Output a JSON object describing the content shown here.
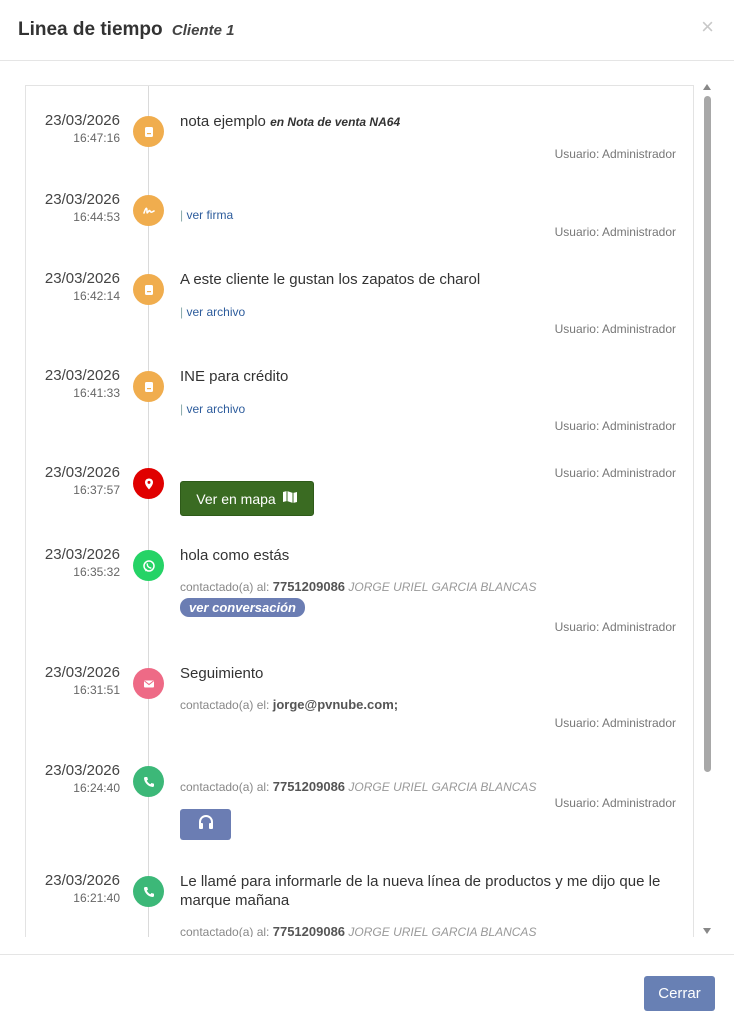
{
  "header": {
    "title": "Linea de tiempo",
    "subtitle": "Cliente 1",
    "close_label": "×"
  },
  "colors": {
    "note": "#f0ad4e",
    "signature": "#f0ad4e",
    "location": "#e00000",
    "whatsapp": "#25d366",
    "email": "#ee6a86",
    "phone": "#3cb878",
    "map_button": "#3a6b22",
    "accent": "#6880b4"
  },
  "entries": [
    {
      "date": "23/03/2026",
      "time": "16:47:16",
      "icon": "note-icon",
      "message": "nota ejemplo",
      "message_suffix": "en Nota de venta NA64",
      "user": "Usuario: Administrador"
    },
    {
      "date": "23/03/2026",
      "time": "16:44:53",
      "icon": "signature-icon",
      "link_sep": "|",
      "link": "ver firma",
      "user": "Usuario: Administrador"
    },
    {
      "date": "23/03/2026",
      "time": "16:42:14",
      "icon": "note-icon",
      "message": "A este cliente le gustan los zapatos de charol",
      "link_sep": "|",
      "link": "ver archivo",
      "user": "Usuario: Administrador"
    },
    {
      "date": "23/03/2026",
      "time": "16:41:33",
      "icon": "note-icon",
      "message": "INE para crédito",
      "link_sep": "|",
      "link": "ver archivo",
      "user": "Usuario: Administrador"
    },
    {
      "date": "23/03/2026",
      "time": "16:37:57",
      "icon": "map-pin-icon",
      "user": "Usuario: Administrador",
      "button": "Ver en mapa"
    },
    {
      "date": "23/03/2026",
      "time": "16:35:32",
      "icon": "whatsapp-icon",
      "message": "hola como estás",
      "contact_label": "contactado(a) al:",
      "contact_value": "7751209086",
      "contact_name": "JORGE URIEL GARCIA BLANCAS",
      "chip": "ver conversación",
      "user": "Usuario: Administrador"
    },
    {
      "date": "23/03/2026",
      "time": "16:31:51",
      "icon": "envelope-icon",
      "message": "Seguimiento",
      "contact_label": "contactado(a) el:",
      "contact_value": "jorge@pvnube.com;",
      "user": "Usuario: Administrador"
    },
    {
      "date": "23/03/2026",
      "time": "16:24:40",
      "icon": "phone-icon",
      "contact_label": "contactado(a) al:",
      "contact_value": "7751209086",
      "contact_name": "JORGE URIEL GARCIA BLANCAS",
      "user": "Usuario: Administrador"
    },
    {
      "date": "23/03/2026",
      "time": "16:21:40",
      "icon": "phone-icon",
      "message_line1": "Le llamé para informarle de la nueva línea de productos y me dijo que le",
      "message_line2": "marque mañana",
      "contact_label": "contactado(a) al:",
      "contact_value": "7751209086",
      "contact_name": "JORGE URIEL GARCIA BLANCAS"
    }
  ],
  "footer": {
    "close_button": "Cerrar"
  }
}
